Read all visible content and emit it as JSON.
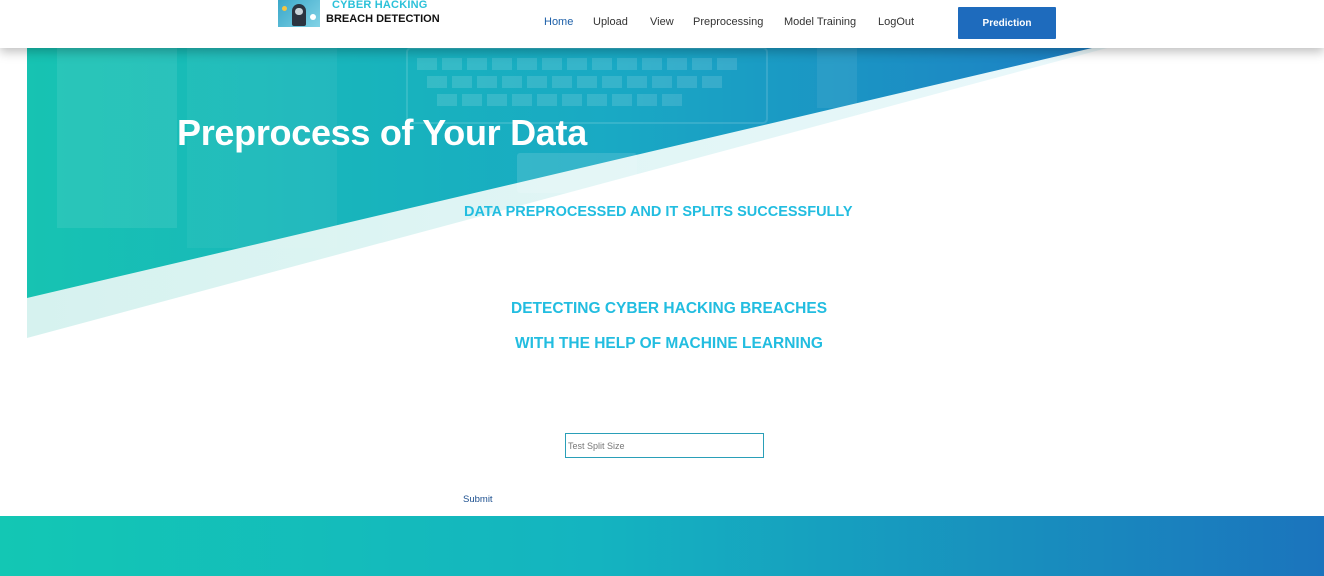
{
  "brand": {
    "line1": "CYBER HACKING",
    "line2": "BREACH DETECTION"
  },
  "nav": {
    "items": [
      "Home",
      "Upload",
      "View",
      "Preprocessing",
      "Model Training",
      "LogOut"
    ],
    "active": "Home",
    "cta": "Prediction"
  },
  "hero": {
    "title": "Preprocess of Your Data"
  },
  "status": {
    "message": "DATA PREPROCESSED AND IT SPLITS SUCCESSFULLY",
    "tagline1": "DETECTING CYBER HACKING BREACHES",
    "tagline2": "WITH THE HELP OF MACHINE LEARNING"
  },
  "form": {
    "split_placeholder": "Test Split Size",
    "split_value": "",
    "submit_label": "Submit"
  },
  "colors": {
    "accent": "#22bde0",
    "brand_blue": "#1e6bbd",
    "teal": "#13c7b4"
  }
}
